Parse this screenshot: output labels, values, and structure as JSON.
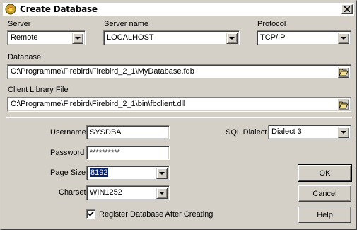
{
  "window": {
    "title": "Create Database",
    "close_glyph": "✕"
  },
  "server": {
    "label": "Server",
    "value": "Remote"
  },
  "server_name": {
    "label": "Server name",
    "value": "LOCALHOST"
  },
  "protocol": {
    "label": "Protocol",
    "value": "TCP/IP"
  },
  "database": {
    "label": "Database",
    "value": "C:\\Programme\\Firebird\\Firebird_2_1\\MyDatabase.fdb"
  },
  "client_library": {
    "label": "Client Library File",
    "value": "C:\\Programme\\Firebird\\Firebird_2_1\\bin\\fbclient.dll"
  },
  "username": {
    "label": "Username",
    "value": "SYSDBA"
  },
  "password": {
    "label": "Password",
    "value": "**********"
  },
  "page_size": {
    "label": "Page Size",
    "value": "8192"
  },
  "charset": {
    "label": "Charset",
    "value": "WIN1252"
  },
  "sql_dialect": {
    "label": "SQL Dialect",
    "value": "Dialect 3"
  },
  "register_checkbox": {
    "label": "Register Database After Creating",
    "checked": true
  },
  "buttons": {
    "ok": "OK",
    "cancel": "Cancel",
    "help": "Help"
  },
  "icons": {
    "title": "database-app-icon",
    "folder": "open-folder-icon",
    "dropdown": "chevron-down-icon"
  }
}
